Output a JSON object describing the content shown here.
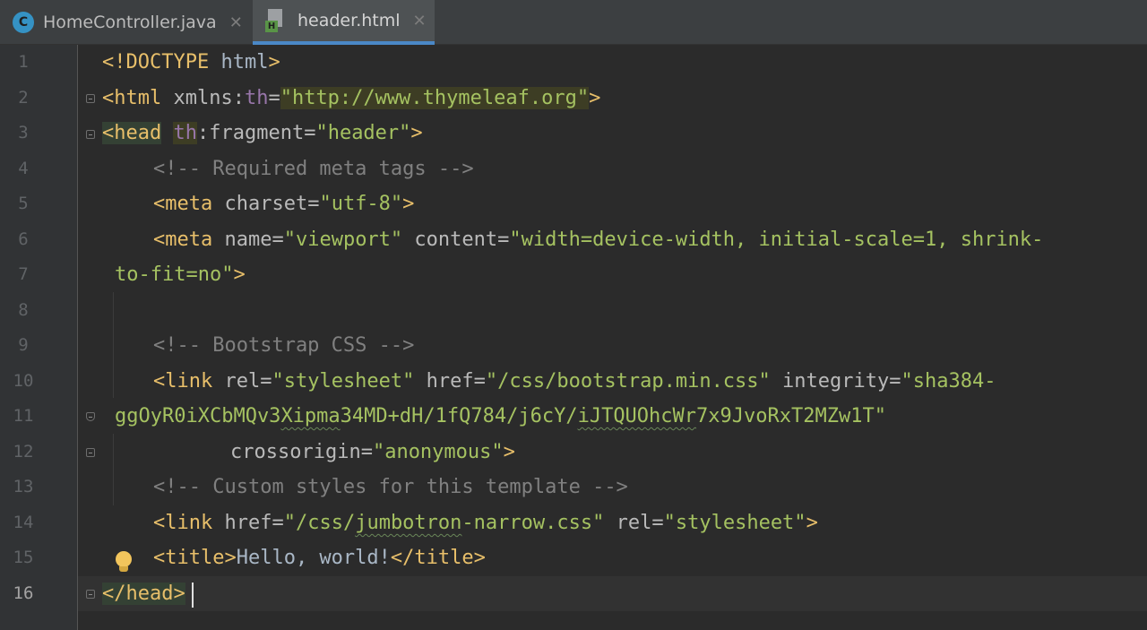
{
  "tabs": [
    {
      "label": "HomeController.java",
      "icon": "java-class-icon",
      "icon_letter": "C",
      "active": false
    },
    {
      "label": "header.html",
      "icon": "html-file-icon",
      "icon_letter": "H",
      "active": true
    }
  ],
  "tab_close_glyph": "✕",
  "editor": {
    "line_numbers": [
      "1",
      "2",
      "3",
      "4",
      "5",
      "6",
      "7",
      "8",
      "9",
      "10",
      "11",
      "12",
      "13",
      "14",
      "15",
      "16"
    ],
    "current_line": "16",
    "lines": {
      "l1": {
        "tag": "<!DOCTYPE",
        "text": " html",
        "end": ">"
      },
      "l2": {
        "tag_open": "<html",
        "attr": " xmlns:",
        "ns": "th",
        "eq": "=",
        "val": "\"http://www.thymeleaf.org\"",
        "end": ">"
      },
      "l3": {
        "tag_open": "<head",
        "sp": " ",
        "ns": "th",
        "attr": ":fragment",
        "eq": "=",
        "val": "\"header\"",
        "end": ">"
      },
      "l4": {
        "comment": "<!-- Required meta tags -->"
      },
      "l5": {
        "tag_open": "<meta",
        "attr": " charset",
        "eq": "=",
        "val": "\"utf-8\"",
        "end": ">"
      },
      "l6": {
        "tag_open": "<meta",
        "attr1": " name",
        "eq1": "=",
        "val1": "\"viewport\"",
        "attr2": " content",
        "eq2": "=",
        "val2": "\"width=device-width, initial-scale=1, shrink-"
      },
      "l7": {
        "val": "to-fit=no\"",
        "end": ">"
      },
      "l9": {
        "comment": "<!-- Bootstrap CSS -->"
      },
      "l10": {
        "tag_open": "<link",
        "attr1": " rel",
        "eq1": "=",
        "val1": "\"stylesheet\"",
        "attr2": " href",
        "eq2": "=",
        "val2": "\"/css/bootstrap.min.css\"",
        "attr3": " integrity",
        "eq3": "=",
        "val3": "\"sha384-"
      },
      "l11": {
        "val_a": "ggOyR0iXCbMQv3",
        "val_b": "Xipma",
        "val_c": "34MD+dH/1fQ784/j6cY/",
        "val_d": "iJTQUOhcWr",
        "val_e": "7x9JvoRxT2MZw1T\""
      },
      "l12": {
        "attr": "crossorigin",
        "eq": "=",
        "val": "\"anonymous\"",
        "end": ">"
      },
      "l13": {
        "comment": "<!-- Custom styles for this template -->"
      },
      "l14": {
        "tag_open": "<link",
        "attr1": " href",
        "eq1": "=",
        "val1_a": "\"/css/",
        "val1_b": "jumbotron",
        "val1_c": "-narrow.css\"",
        "attr2": " rel",
        "eq2": "=",
        "val2": "\"stylesheet\"",
        "end": ">"
      },
      "l15": {
        "tag_open": "<title>",
        "text": "Hello, world!",
        "tag_close": "</title>"
      },
      "l16": {
        "tag": "</head>"
      }
    }
  },
  "colors": {
    "background": "#2b2b2b",
    "gutter": "#313335",
    "tag": "#e8bf6a",
    "attribute": "#bababa",
    "value": "#a5c261",
    "comment": "#808080",
    "namespace": "#9876aa",
    "accent": "#4a88c7"
  }
}
